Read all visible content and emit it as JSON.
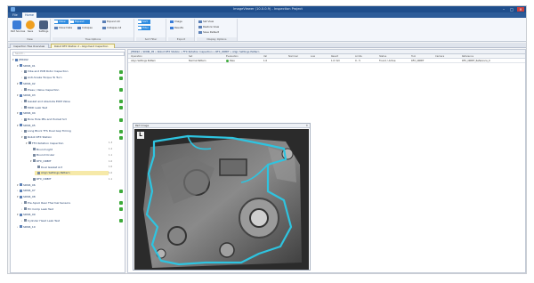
{
  "window": {
    "title": "ImageViewer (10.0.0.9) - Inspection Project",
    "controls": {
      "minimize": "–",
      "maximize": "□",
      "close": "✕"
    }
  },
  "ribbon": {
    "tabs": [
      {
        "label": "File"
      },
      {
        "label": "Home"
      }
    ],
    "groups": {
      "view": {
        "label": "View",
        "buttons": [
          "Part Sources",
          "Save",
          "Settings"
        ]
      },
      "tree_options": {
        "label": "Tree Options",
        "buttons": [
          "Show",
          "Expand",
          "Show Data",
          "Collapse",
          "Expand All",
          "Collapse All"
        ]
      },
      "sort_filter": {
        "label": "Sort Filter",
        "buttons": [
          "Sort",
          "Filter"
        ]
      },
      "export": {
        "label": "Export",
        "buttons": [
          "Image",
          "Results"
        ]
      },
      "display_options": {
        "label": "Display Options",
        "buttons": [
          "Set View",
          "Restore View",
          "Save Default"
        ]
      }
    }
  },
  "doc_tabs": [
    {
      "label": "Inspection Tree Overview"
    },
    {
      "label": "Robot RFX Station 2 - Alignment Inspection"
    }
  ],
  "tree": {
    "search_placeholder": "Search...",
    "rows": [
      {
        "label": "JH8492",
        "indent": 0,
        "type": "root",
        "toggle": "▾"
      },
      {
        "label": "SDN6_01",
        "indent": 1,
        "type": "station",
        "toggle": "▾"
      },
      {
        "label": "Vibe and PCB Rotor Inspection",
        "indent": 2,
        "type": "op",
        "toggle": "›",
        "ok": true
      },
      {
        "label": "Anti-Snake Torque To Turn",
        "indent": 2,
        "type": "op",
        "toggle": "›",
        "ok": true
      },
      {
        "label": "SDN6_02",
        "indent": 1,
        "type": "station",
        "toggle": "▾"
      },
      {
        "label": "Press / Valve Inspection",
        "indent": 2,
        "type": "op",
        "toggle": "›",
        "ok": true
      },
      {
        "label": "SDN6_03",
        "indent": 1,
        "type": "station",
        "toggle": "▾"
      },
      {
        "label": "Gasket and Absolute EOM Valve",
        "indent": 2,
        "type": "op",
        "toggle": "›",
        "ok": true
      },
      {
        "label": "MDD Leak Test",
        "indent": 2,
        "type": "op",
        "toggle": "›",
        "ok": true
      },
      {
        "label": "SDN6_04",
        "indent": 1,
        "type": "station",
        "toggle": "▾"
      },
      {
        "label": "Bore Hole PPs and Pocket Sct",
        "indent": 2,
        "type": "op",
        "toggle": "›",
        "ok": true
      },
      {
        "label": "SDN6_05",
        "indent": 1,
        "type": "station",
        "toggle": "▾"
      },
      {
        "label": "Long Block TTS Dual Gap Timing",
        "indent": 2,
        "type": "op",
        "toggle": "›",
        "ok": true
      },
      {
        "label": "Robot RFX Station",
        "indent": 2,
        "type": "op",
        "toggle": "▾",
        "ok": true
      },
      {
        "label": "FFX Rotation Inspection",
        "indent": 3,
        "type": "op",
        "toggle": "▾",
        "num": "1.3"
      },
      {
        "label": "Bound Light",
        "indent": 4,
        "type": "op",
        "toggle": "",
        "num": "1.2"
      },
      {
        "label": "Bound Ocular",
        "indent": 4,
        "type": "op",
        "toggle": "",
        "num": "1.1"
      },
      {
        "label": "RFX_ORBIT",
        "indent": 4,
        "type": "op",
        "toggle": "▾",
        "num": "1.0"
      },
      {
        "label": "Dual Gasket Act",
        "indent": 5,
        "type": "op",
        "toggle": "",
        "num": "1.0"
      },
      {
        "label": "Align Settings Pattern",
        "indent": 5,
        "type": "op",
        "toggle": "",
        "num": "1.0",
        "selected": true
      },
      {
        "label": "RFX_ORBIT",
        "indent": 4,
        "type": "op",
        "toggle": "",
        "num": "1.1"
      },
      {
        "label": "SDN6_06",
        "indent": 1,
        "type": "station",
        "toggle": "▾"
      },
      {
        "label": "SDN6_07",
        "indent": 1,
        "type": "station",
        "toggle": "›",
        "ok": true
      },
      {
        "label": "SDN6_08",
        "indent": 1,
        "type": "station",
        "toggle": "▾"
      },
      {
        "label": "Pre-Spool Rear Thermal Sensors",
        "indent": 2,
        "type": "op",
        "toggle": "›",
        "ok": true
      },
      {
        "label": "HC Comp Leak Test",
        "indent": 2,
        "type": "op",
        "toggle": "›",
        "ok": true
      },
      {
        "label": "SDN6_09",
        "indent": 1,
        "type": "station",
        "toggle": "▾"
      },
      {
        "label": "Cylinder Head Leak Test",
        "indent": 2,
        "type": "op",
        "toggle": "›",
        "ok": true
      },
      {
        "label": "SDN6_10",
        "indent": 1,
        "type": "station",
        "toggle": "›"
      }
    ]
  },
  "main": {
    "breadcrumb": "JH8492 » SDN6_05 » Robot RFX Station » FFX Rotation Inspection » RFX_ORBIT » Align Settings Pattern",
    "columns": [
      "Operation",
      "Set",
      "Evaluation",
      "Val",
      "Nominal",
      "Low",
      "Result",
      "Limits",
      "Status",
      "Tool",
      "Camera",
      "Reference"
    ],
    "row": {
      "operation": "Align Settings Pattern",
      "set": "Normal Pattern",
      "evaluation": "Pass",
      "val": "1.0",
      "nominal": "",
      "low": "",
      "result": "1.0 mm",
      "limits": "0 - 5",
      "status": "Found / Active",
      "tool": "RFX_ORBIT",
      "camera": "",
      "reference": "RFX_ORBIT_Reference_0"
    },
    "image_panel": {
      "title": "Part Image",
      "close": "✕",
      "badge": "L"
    }
  },
  "colors": {
    "titlebar": "#1f4e8c",
    "ribbon_tabs": "#2d5c99",
    "accent": "#2f8ce0",
    "ok_green": "#3daa3a",
    "selected_row": "#f6e9a8",
    "outline_cyan": "#2ec4e0"
  }
}
